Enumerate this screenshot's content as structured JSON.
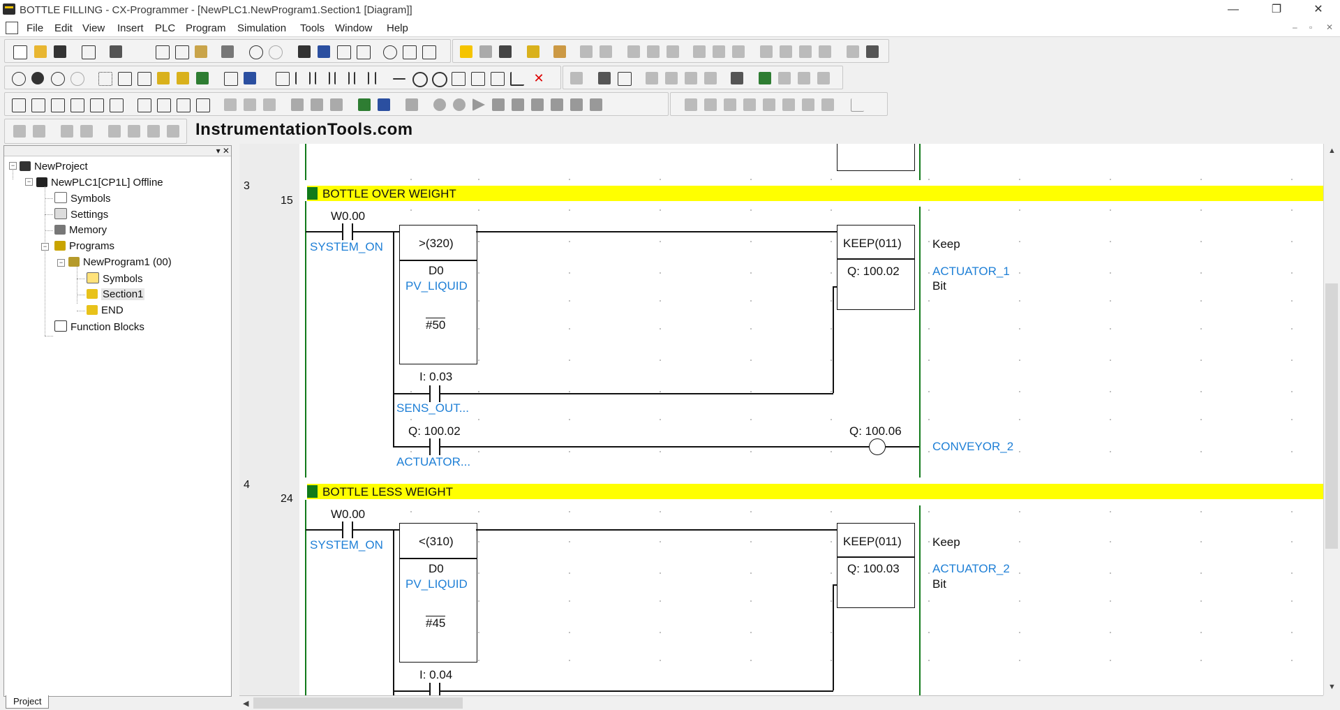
{
  "window": {
    "title": "BOTTLE FILLING - CX-Programmer - [NewPLC1.NewProgram1.Section1 [Diagram]]",
    "controls": [
      "—",
      "❐",
      "✕"
    ]
  },
  "menu": {
    "items": [
      "File",
      "Edit",
      "View",
      "Insert",
      "PLC",
      "Program",
      "Simulation",
      "Tools",
      "Window",
      "Help"
    ],
    "mdi_controls": [
      "–",
      "▫",
      "✕"
    ]
  },
  "brand": "InstrumentationTools.com",
  "project_tree": {
    "items": [
      {
        "label": "NewProject"
      },
      {
        "label": "NewPLC1[CP1L] Offline"
      },
      {
        "label": "Symbols"
      },
      {
        "label": "Settings"
      },
      {
        "label": "Memory"
      },
      {
        "label": "Programs"
      },
      {
        "label": "NewProgram1 (00)"
      },
      {
        "label": "Symbols"
      },
      {
        "label": "Section1"
      },
      {
        "label": "END"
      },
      {
        "label": "Function Blocks"
      }
    ],
    "tab": "Project"
  },
  "rungs": [
    {
      "number": "3",
      "step": "15",
      "comment": "BOTTLE OVER WEIGHT",
      "contact1_addr": "W0.00",
      "contact1_sym": "SYSTEM_ON",
      "cmp_op": ">(320)",
      "cmp_operand": "D0",
      "cmp_sym": "PV_LIQUID",
      "cmp_const": "#50",
      "contact2_addr": "I: 0.03",
      "contact2_sym": "SENS_OUT...",
      "contact3_addr": "Q: 100.02",
      "contact3_sym": "ACTUATOR...",
      "keep_title": "KEEP(011)",
      "keep_operand": "Q: 100.02",
      "keep_comment": "Keep",
      "keep_sym": "ACTUATOR_1",
      "keep_sub": "Bit",
      "coil_addr": "Q: 100.06",
      "coil_sym": "CONVEYOR_2"
    },
    {
      "number": "4",
      "step": "24",
      "comment": "BOTTLE LESS WEIGHT",
      "contact1_addr": "W0.00",
      "contact1_sym": "SYSTEM_ON",
      "cmp_op": "<(310)",
      "cmp_operand": "D0",
      "cmp_sym": "PV_LIQUID",
      "cmp_const": "#45",
      "contact2_addr": "I: 0.04",
      "keep_title": "KEEP(011)",
      "keep_operand": "Q: 100.03",
      "keep_comment": "Keep",
      "keep_sym": "ACTUATOR_2",
      "keep_sub": "Bit"
    }
  ],
  "colors": {
    "comment_bar": "#ffff00",
    "comment_marker": "#117a1a",
    "symbol_text": "#1e7fd6",
    "rail": "#117a1a"
  }
}
